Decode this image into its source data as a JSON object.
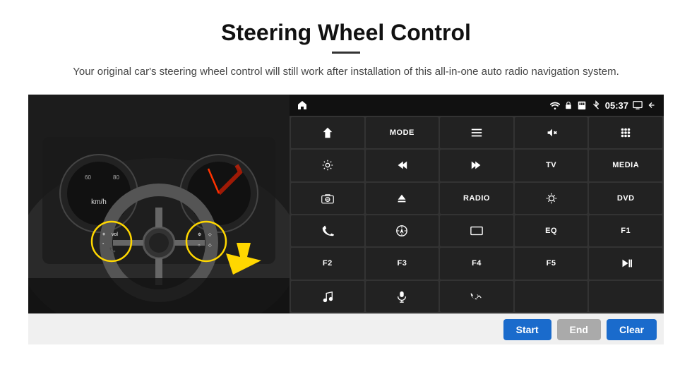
{
  "page": {
    "title": "Steering Wheel Control",
    "subtitle": "Your original car's steering wheel control will still work after installation of this all-in-one auto radio navigation system."
  },
  "status_bar": {
    "time": "05:37"
  },
  "buttons": [
    {
      "id": "nav",
      "icon": "house",
      "text": "",
      "row": 1,
      "col": 1
    },
    {
      "id": "mode",
      "icon": "",
      "text": "MODE",
      "row": 1,
      "col": 2
    },
    {
      "id": "menu",
      "icon": "menu",
      "text": "",
      "row": 1,
      "col": 3
    },
    {
      "id": "mute",
      "icon": "mute",
      "text": "",
      "row": 1,
      "col": 4
    },
    {
      "id": "apps",
      "icon": "apps",
      "text": "",
      "row": 1,
      "col": 5
    },
    {
      "id": "settings",
      "icon": "gear",
      "text": "",
      "row": 2,
      "col": 1
    },
    {
      "id": "prev",
      "icon": "prev",
      "text": "",
      "row": 2,
      "col": 2
    },
    {
      "id": "next",
      "icon": "next",
      "text": "",
      "row": 2,
      "col": 3
    },
    {
      "id": "tv",
      "icon": "",
      "text": "TV",
      "row": 2,
      "col": 4
    },
    {
      "id": "media",
      "icon": "",
      "text": "MEDIA",
      "row": 2,
      "col": 5
    },
    {
      "id": "cam360",
      "icon": "cam360",
      "text": "",
      "row": 3,
      "col": 1
    },
    {
      "id": "eject",
      "icon": "eject",
      "text": "",
      "row": 3,
      "col": 2
    },
    {
      "id": "radio",
      "icon": "",
      "text": "RADIO",
      "row": 3,
      "col": 3
    },
    {
      "id": "bright",
      "icon": "bright",
      "text": "",
      "row": 3,
      "col": 4
    },
    {
      "id": "dvd",
      "icon": "",
      "text": "DVD",
      "row": 3,
      "col": 5
    },
    {
      "id": "phone",
      "icon": "phone",
      "text": "",
      "row": 4,
      "col": 1
    },
    {
      "id": "navi",
      "icon": "navi",
      "text": "",
      "row": 4,
      "col": 2
    },
    {
      "id": "rect",
      "icon": "rect",
      "text": "",
      "row": 4,
      "col": 3
    },
    {
      "id": "eq",
      "icon": "",
      "text": "EQ",
      "row": 4,
      "col": 4
    },
    {
      "id": "f1",
      "icon": "",
      "text": "F1",
      "row": 4,
      "col": 5
    },
    {
      "id": "f2",
      "icon": "",
      "text": "F2",
      "row": 5,
      "col": 1
    },
    {
      "id": "f3",
      "icon": "",
      "text": "F3",
      "row": 5,
      "col": 2
    },
    {
      "id": "f4",
      "icon": "",
      "text": "F4",
      "row": 5,
      "col": 3
    },
    {
      "id": "f5",
      "icon": "",
      "text": "F5",
      "row": 5,
      "col": 4
    },
    {
      "id": "playpause",
      "icon": "playpause",
      "text": "",
      "row": 5,
      "col": 5
    },
    {
      "id": "music",
      "icon": "music",
      "text": "",
      "row": 6,
      "col": 1
    },
    {
      "id": "mic",
      "icon": "mic",
      "text": "",
      "row": 6,
      "col": 2
    },
    {
      "id": "volphone",
      "icon": "volphone",
      "text": "",
      "row": 6,
      "col": 3
    },
    {
      "id": "empty1",
      "icon": "",
      "text": "",
      "row": 6,
      "col": 4
    },
    {
      "id": "empty2",
      "icon": "",
      "text": "",
      "row": 6,
      "col": 5
    }
  ],
  "bottom_buttons": {
    "start": "Start",
    "end": "End",
    "clear": "Clear"
  }
}
